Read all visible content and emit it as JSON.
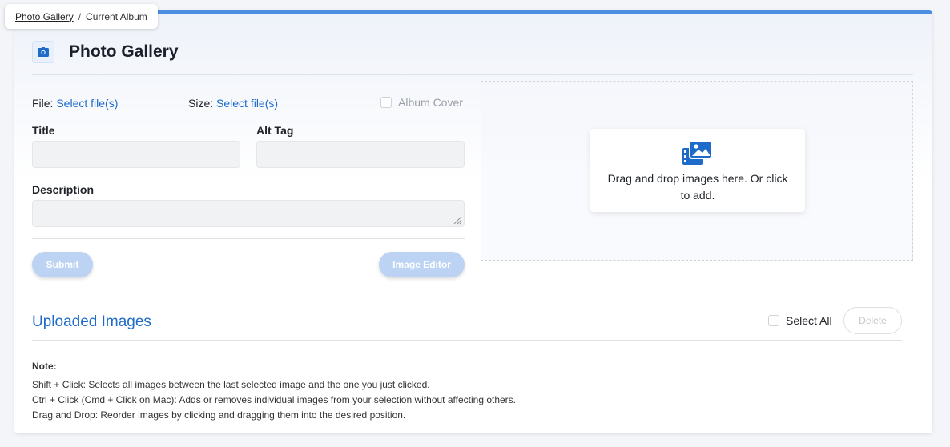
{
  "breadcrumb": {
    "root": "Photo Gallery",
    "separator": "/",
    "current": "Current Album"
  },
  "header": {
    "title": "Photo Gallery",
    "icon": "camera-icon"
  },
  "form": {
    "file_label": "File:",
    "file_link": "Select file(s)",
    "size_label": "Size:",
    "size_link": "Select file(s)",
    "album_cover_label": "Album Cover",
    "title_label": "Title",
    "title_value": "",
    "alt_tag_label": "Alt Tag",
    "alt_tag_value": "",
    "description_label": "Description",
    "description_value": "",
    "submit_label": "Submit",
    "image_editor_label": "Image Editor"
  },
  "dropzone": {
    "icon": "images-icon",
    "text": "Drag and drop images here. Or click to add."
  },
  "uploaded": {
    "title": "Uploaded Images",
    "select_all_label": "Select All",
    "delete_label": "Delete"
  },
  "note": {
    "title": "Note:",
    "lines": [
      "Shift + Click: Selects all images between the last selected image and the one you just clicked.",
      "Ctrl + Click (Cmd + Click on Mac): Adds or removes individual images from your selection without affecting others.",
      "Drag and Drop: Reorder images by clicking and dragging them into the desired position."
    ]
  },
  "colors": {
    "accent": "#1e6bc9",
    "top_border": "#4a8fe0",
    "soft_button": "#bcd3f3"
  }
}
